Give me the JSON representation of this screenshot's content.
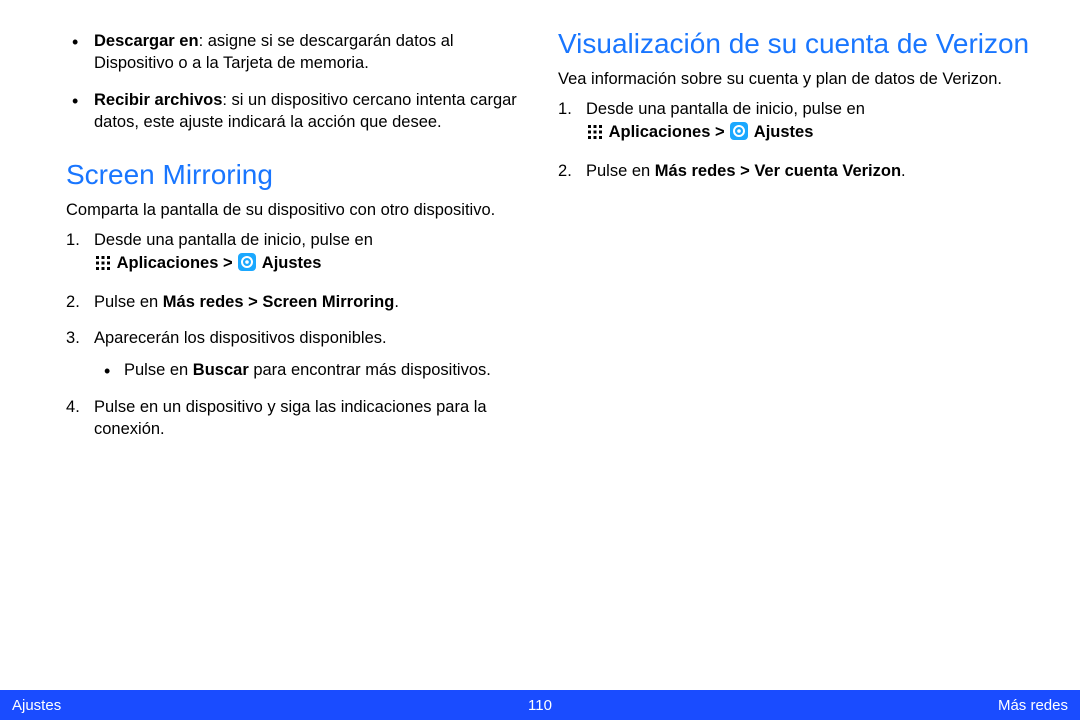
{
  "left": {
    "bullets": [
      {
        "bold": "Descargar en",
        "rest": ": asigne si se descargarán datos al Dispositivo o a la Tarjeta de memoria."
      },
      {
        "bold": "Recibir archivos",
        "rest": ": si un dispositivo cercano intenta cargar datos, este ajuste indicará la acción que desee."
      }
    ],
    "heading": "Screen Mirroring",
    "desc": "Comparta la pantalla de su dispositivo con otro dispositivo.",
    "steps": {
      "s1_pre": "Desde una pantalla de inicio, pulse en ",
      "s1_apps": "Aplicaciones > ",
      "s1_ajustes": "Ajustes",
      "s2_pre": "Pulse en ",
      "s2_bold": "Más redes > Screen Mirroring",
      "s2_post": ".",
      "s3": "Aparecerán los dispositivos disponibles.",
      "s3_bullet_pre": "Pulse en ",
      "s3_bullet_bold": "Buscar",
      "s3_bullet_post": " para encontrar más dispositivos.",
      "s4": "Pulse en un dispositivo y siga las indicaciones para la conexión."
    }
  },
  "right": {
    "heading": "Visualización de su cuenta de Verizon",
    "desc": "Vea información sobre su cuenta y plan de datos de Verizon.",
    "steps": {
      "s1_pre": "Desde una pantalla de inicio, pulse en ",
      "s1_apps": "Aplicaciones > ",
      "s1_ajustes": "Ajustes",
      "s2_pre": "Pulse en ",
      "s2_bold": "Más redes > Ver cuenta Verizon",
      "s2_post": "."
    }
  },
  "footer": {
    "left": "Ajustes",
    "center": "110",
    "right": "Más redes"
  }
}
